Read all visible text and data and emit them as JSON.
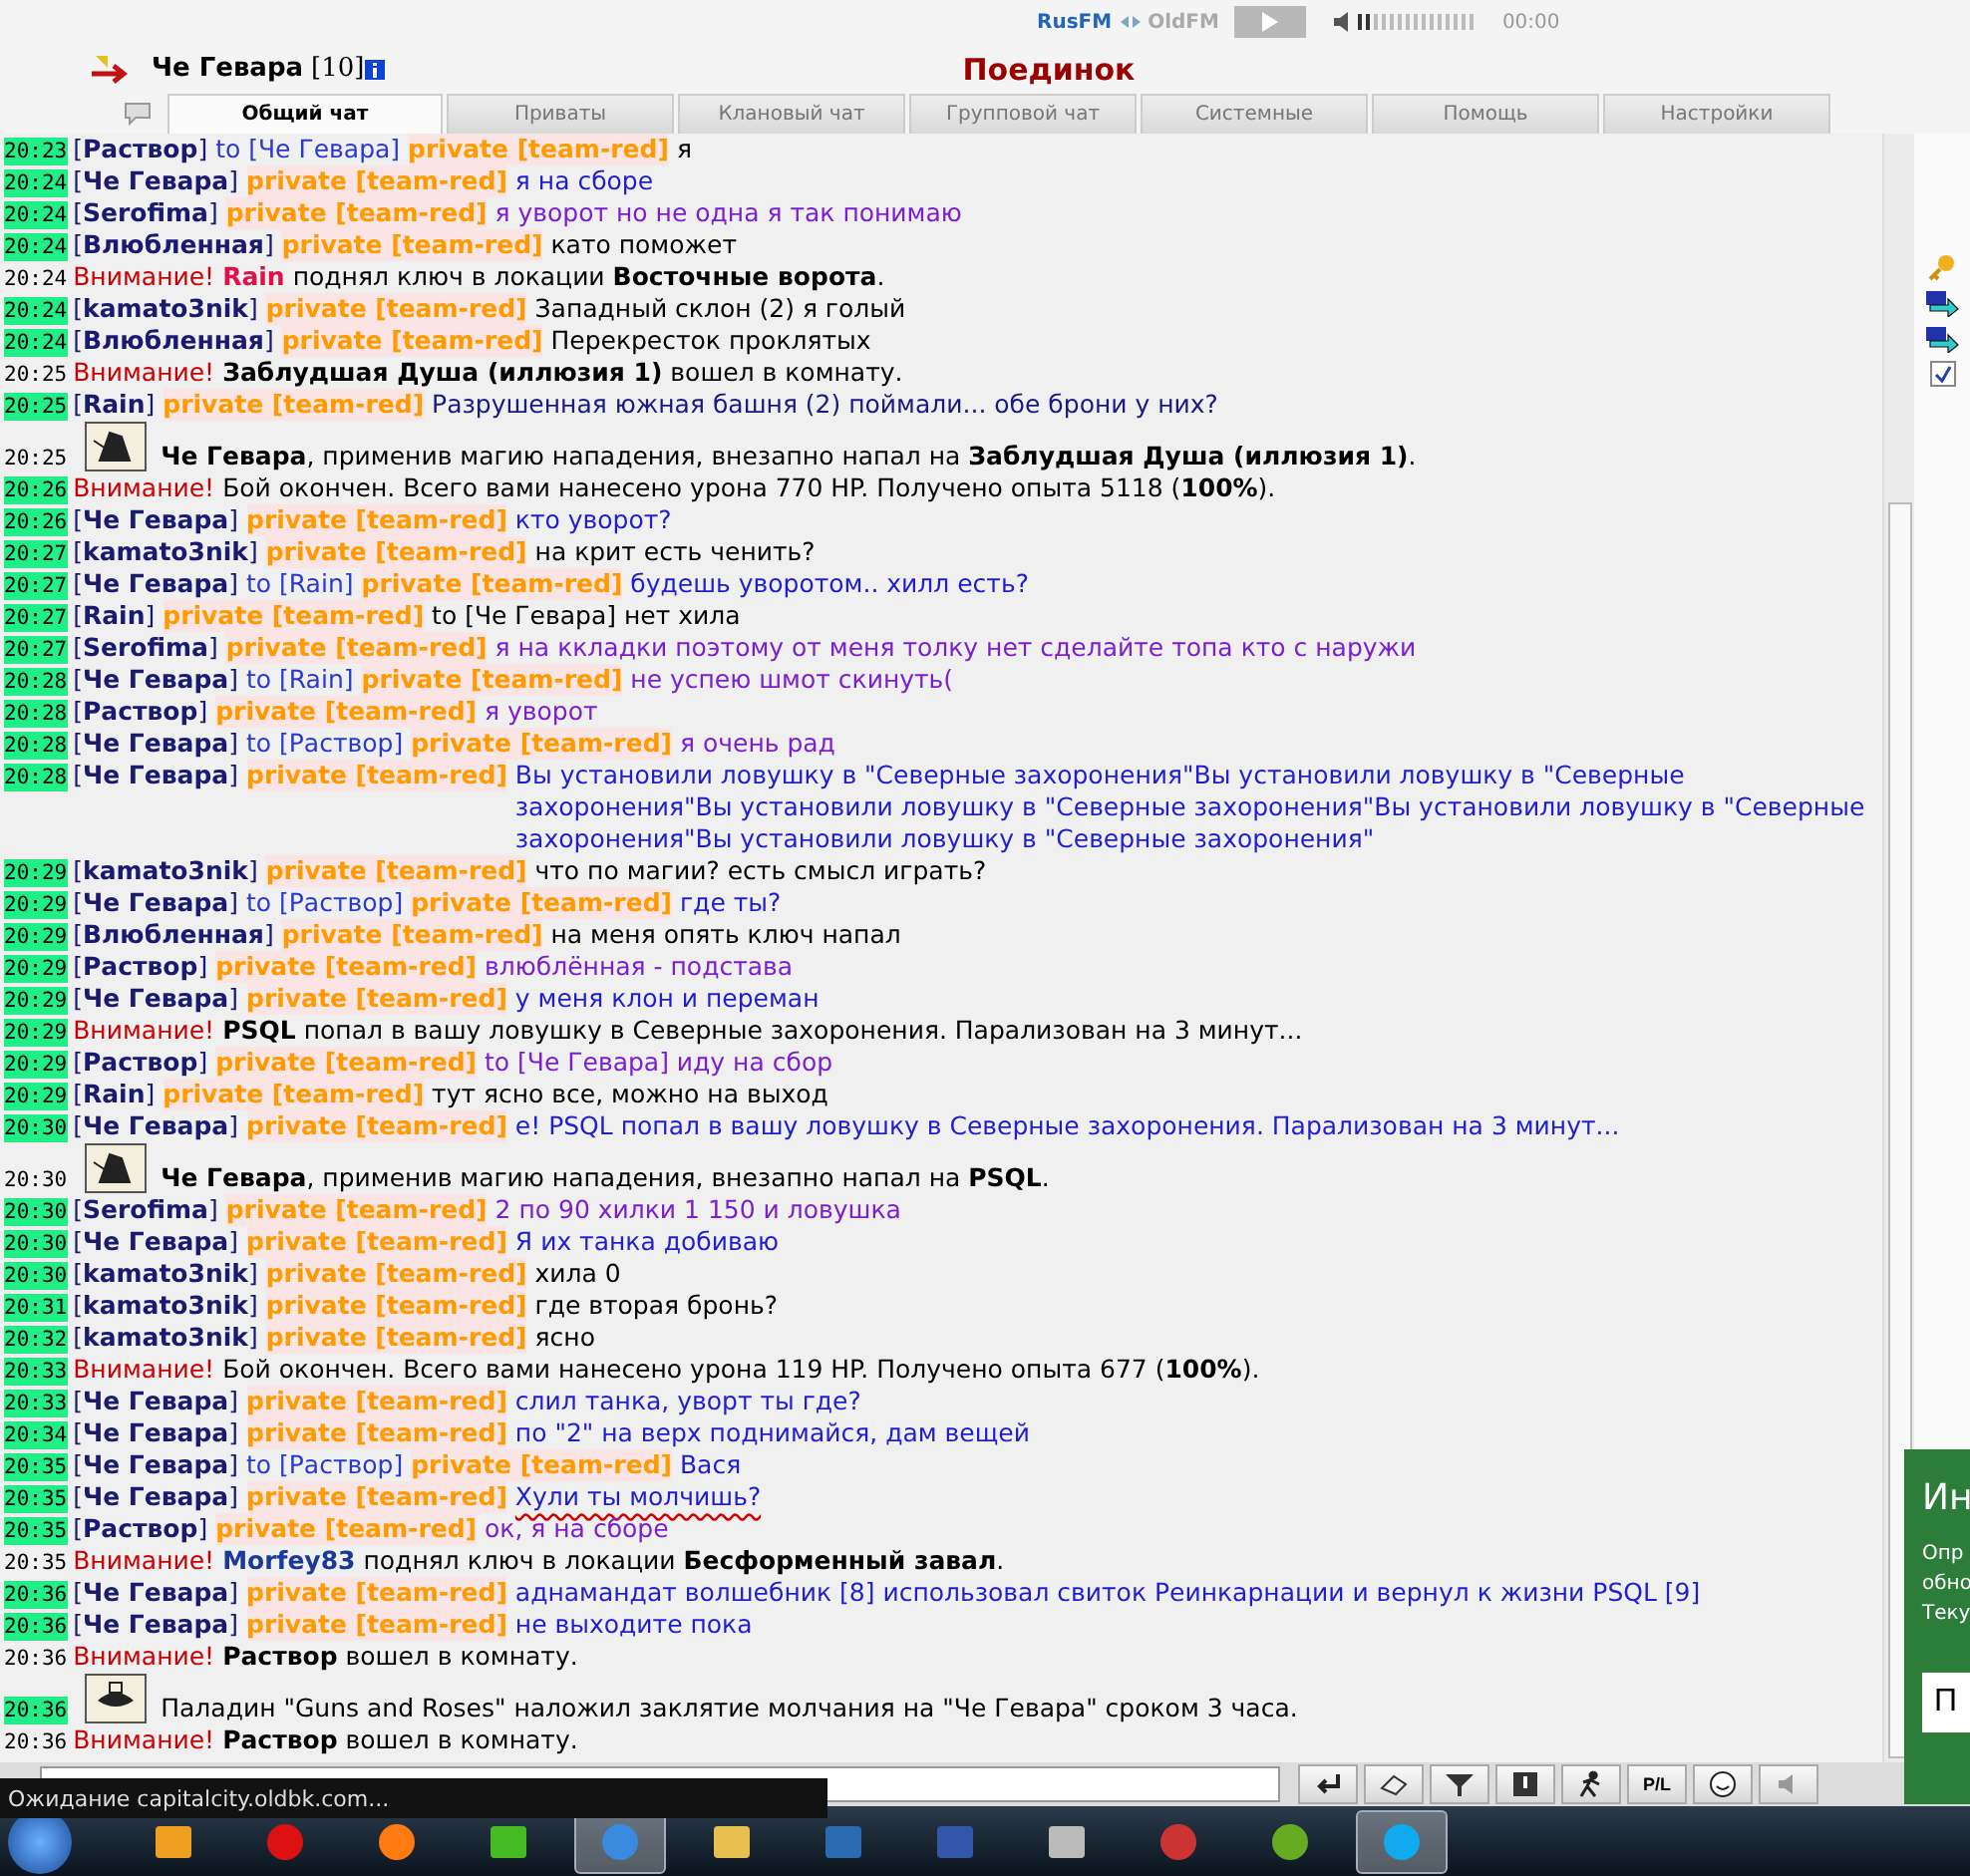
{
  "radio": {
    "station": "RusFM",
    "alt_station": "OldFM",
    "time": "00:00",
    "level": 0.12
  },
  "header": {
    "name": "Че Гевара",
    "level": "[10]",
    "location": "Поединок"
  },
  "tabs": [
    {
      "label": "Общий чат",
      "selected": true
    },
    {
      "label": "Приваты",
      "selected": false
    },
    {
      "label": "Клановый чат",
      "selected": false
    },
    {
      "label": "Групповой чат",
      "selected": false
    },
    {
      "label": "Системные",
      "selected": false
    },
    {
      "label": "Помощь",
      "selected": false
    },
    {
      "label": "Настройки",
      "selected": false
    }
  ],
  "messages": [
    {
      "kind": "private",
      "time": "20:23",
      "highlighted": true,
      "sender": "[**Раствор**]",
      "to": "to [Че Гевара]",
      "channel": "private [team-red]",
      "text": "я",
      "color": "#000000"
    },
    {
      "kind": "private",
      "time": "20:24",
      "highlighted": true,
      "sender": "[**Че Гевара**]",
      "channel": "private [team-red]",
      "text": "я на сборе",
      "color": "#1f1fd0"
    },
    {
      "kind": "private",
      "time": "20:24",
      "highlighted": true,
      "sender": "[**Serofima**]",
      "channel": "private [team-red]",
      "text": "я уворот но не одна я так понимаю",
      "color": "#7b1fd0"
    },
    {
      "kind": "private",
      "time": "20:24",
      "highlighted": true,
      "sender": "[**Влюбленная**]",
      "channel": "private [team-red]",
      "text": "като поможет",
      "color": "#000000"
    },
    {
      "kind": "system",
      "time": "20:24",
      "highlighted": false,
      "alert": "Внимание!",
      "actor": "Rain",
      "color": "#e0104a",
      "text": "поднял ключ в локации **Восточные ворота**."
    },
    {
      "kind": "private",
      "time": "20:24",
      "highlighted": true,
      "sender": "[**kamato3nik**]",
      "channel": "private [team-red]",
      "text": "Западный склон (2) я голый",
      "color": "#000000"
    },
    {
      "kind": "private",
      "time": "20:24",
      "highlighted": true,
      "sender": "[**Влюбленная**]",
      "channel": "private [team-red]",
      "text": "Перекресток проклятых",
      "color": "#000000"
    },
    {
      "kind": "system",
      "time": "20:25",
      "highlighted": false,
      "alert": "Внимание!",
      "text": "**Заблудшая Душа (иллюзия 1)** вошел в комнату."
    },
    {
      "kind": "private",
      "time": "20:25",
      "highlighted": true,
      "sender": "[**Rain**]",
      "channel": "private [team-red]",
      "text": "Разрушенная южная башня (2) поймали... обе брони у них?",
      "color": "#1a1a80"
    },
    {
      "kind": "attack",
      "time": "20:25",
      "highlighted": false,
      "text": "**Че Гевара**, применив магию нападения, внезапно напал на **Заблудшая Душа (иллюзия 1)**."
    },
    {
      "kind": "system",
      "time": "20:26",
      "highlighted": true,
      "alert": "Внимание!",
      "text": "Бой окончен. Всего вами нанесено урона 770 HP. Получено опыта 5118 (**100%**)."
    },
    {
      "kind": "private",
      "time": "20:26",
      "highlighted": true,
      "sender": "[**Че Гевара**]",
      "channel": "private [team-red]",
      "text": "кто уворот?",
      "color": "#1f1fd0"
    },
    {
      "kind": "private",
      "time": "20:27",
      "highlighted": true,
      "sender": "[**kamato3nik**]",
      "channel": "private [team-red]",
      "text": "на крит есть ченить?",
      "color": "#000000"
    },
    {
      "kind": "private",
      "time": "20:27",
      "highlighted": true,
      "sender": "[**Че Гевара**]",
      "to": "to [Rain]",
      "channel": "private [team-red]",
      "text": "будешь уворотом.. хилл есть?",
      "color": "#1f1fd0"
    },
    {
      "kind": "private",
      "time": "20:27",
      "highlighted": true,
      "sender": "[**Rain**]",
      "channel": "private [team-red]",
      "text": "to [Че Гевара] нет хила",
      "color": "#000000"
    },
    {
      "kind": "private",
      "time": "20:27",
      "highlighted": true,
      "sender": "[**Serofima**]",
      "channel": "private [team-red]",
      "text": "я на ккладки поэтому от меня толку нет сделайте топа кто с наружи",
      "color": "#7b1fd0"
    },
    {
      "kind": "private",
      "time": "20:28",
      "highlighted": true,
      "sender": "[**Че Гевара**]",
      "to": "to [Rain]",
      "channel": "private [team-red]",
      "text": "не успею шмот скинуть(",
      "color": "#7b1fd0"
    },
    {
      "kind": "private",
      "time": "20:28",
      "highlighted": true,
      "sender": "[**Раствор**]",
      "channel": "private [team-red]",
      "text": "я уворот",
      "color": "#7b1fd0"
    },
    {
      "kind": "private",
      "time": "20:28",
      "highlighted": true,
      "sender": "[**Че Гевара**]",
      "to": "to [Раствор]",
      "channel": "private [team-red]",
      "text": "я очень рад",
      "color": "#7b1fd0"
    },
    {
      "kind": "private",
      "time": "20:28",
      "highlighted": true,
      "sender": "[**Че Гевара**]",
      "channel": "private [team-red]",
      "text": "Вы установили ловушку в \"Северные захоронения\"Вы установили ловушку в \"Северные захоронения\"Вы установили ловушку в \"Северные захоронения\"Вы установили ловушку в \"Северные захоронения\"Вы установили ловушку в \"Северные захоронения\"",
      "color": "#1f1fd0"
    },
    {
      "kind": "private",
      "time": "20:29",
      "highlighted": true,
      "sender": "[**kamato3nik**]",
      "channel": "private [team-red]",
      "text": "что по магии? есть смысл играть?",
      "color": "#000000"
    },
    {
      "kind": "private",
      "time": "20:29",
      "highlighted": true,
      "sender": "[**Че Гевара**]",
      "to": "to [Раствор]",
      "channel": "private [team-red]",
      "text": "где ты?",
      "color": "#1f1fd0"
    },
    {
      "kind": "private",
      "time": "20:29",
      "highlighted": true,
      "sender": "[**Влюбленная**]",
      "channel": "private [team-red]",
      "text": "на меня опять ключ напал",
      "color": "#000000"
    },
    {
      "kind": "private",
      "time": "20:29",
      "highlighted": true,
      "sender": "[**Раствор**]",
      "channel": "private [team-red]",
      "text": "влюблённая - подстава",
      "color": "#7b1fd0"
    },
    {
      "kind": "private",
      "time": "20:29",
      "highlighted": true,
      "sender": "[**Че Гевара**]",
      "channel": "private [team-red]",
      "text": "у меня клон и переман",
      "color": "#1f1fd0"
    },
    {
      "kind": "system",
      "time": "20:29",
      "highlighted": true,
      "alert": "Внимание!",
      "actor": "PSQL",
      "color": "#000000",
      "text": "попал в вашу ловушку в Северные захоронения. Парализован на 3 минут..."
    },
    {
      "kind": "private",
      "time": "20:29",
      "highlighted": true,
      "sender": "[**Раствор**]",
      "channel": "private [team-red]",
      "text": "to [Че Гевара] иду на сбор",
      "color": "#7b1fd0"
    },
    {
      "kind": "private",
      "time": "20:29",
      "highlighted": true,
      "sender": "[**Rain**]",
      "channel": "private [team-red]",
      "text": "тут ясно все, можно на выход",
      "color": "#000000"
    },
    {
      "kind": "private",
      "time": "20:30",
      "highlighted": true,
      "sender": "[**Че Гевара**]",
      "channel": "private [team-red]",
      "text": "е! PSQL попал в вашу ловушку в Северные захоронения. Парализован на 3 минут...",
      "color": "#1f1fd0"
    },
    {
      "kind": "attack",
      "time": "20:30",
      "highlighted": false,
      "text": "**Че Гевара**, применив магию нападения, внезапно напал на **PSQL**."
    },
    {
      "kind": "private",
      "time": "20:30",
      "highlighted": true,
      "sender": "[**Serofima**]",
      "channel": "private [team-red]",
      "text": "2 по 90 хилки 1 150 и ловушка",
      "color": "#7b1fd0"
    },
    {
      "kind": "private",
      "time": "20:30",
      "highlighted": true,
      "sender": "[**Че Гевара**]",
      "channel": "private [team-red]",
      "text": "Я их танка добиваю",
      "color": "#1f1fd0"
    },
    {
      "kind": "private",
      "time": "20:30",
      "highlighted": true,
      "sender": "[**kamato3nik**]",
      "channel": "private [team-red]",
      "text": "хила 0",
      "color": "#000000"
    },
    {
      "kind": "private",
      "time": "20:31",
      "highlighted": true,
      "sender": "[**kamato3nik**]",
      "channel": "private [team-red]",
      "text": "где вторая бронь?",
      "color": "#000000"
    },
    {
      "kind": "private",
      "time": "20:32",
      "highlighted": true,
      "sender": "[**kamato3nik**]",
      "channel": "private [team-red]",
      "text": "ясно",
      "color": "#000000"
    },
    {
      "kind": "system",
      "time": "20:33",
      "highlighted": true,
      "alert": "Внимание!",
      "text": "Бой окончен. Всего вами нанесено урона 119 HP. Получено опыта 677 (**100%**)."
    },
    {
      "kind": "private",
      "time": "20:33",
      "highlighted": true,
      "sender": "[**Че Гевара**]",
      "channel": "private [team-red]",
      "text": "слил танка, уворт ты где?",
      "color": "#1f1fd0"
    },
    {
      "kind": "private",
      "time": "20:34",
      "highlighted": true,
      "sender": "[**Че Гевара**]",
      "channel": "private [team-red]",
      "text": "по \"2\" на верх поднимайся, дам вещей",
      "color": "#1f1fd0"
    },
    {
      "kind": "private",
      "time": "20:35",
      "highlighted": true,
      "sender": "[**Че Гевара**]",
      "to": "to [Раствор]",
      "channel": "private [team-red]",
      "text": "Вася",
      "color": "#1f1fd0"
    },
    {
      "kind": "private",
      "time": "20:35",
      "highlighted": true,
      "sender": "[**Че Гевара**]",
      "channel": "private [team-red]",
      "text": "Хули ты молчишь?",
      "color": "#1f1fd0",
      "underlined": true
    },
    {
      "kind": "private",
      "time": "20:35",
      "highlighted": true,
      "sender": "[**Раствор**]",
      "channel": "private [team-red]",
      "text": "ок, я на сборе",
      "color": "#7b1fd0"
    },
    {
      "kind": "system",
      "time": "20:35",
      "highlighted": false,
      "alert": "Внимание!",
      "actor": "Morfey83",
      "color": "#1a3a9a",
      "text": "поднял ключ в локации **Бесформенный завал**."
    },
    {
      "kind": "private",
      "time": "20:36",
      "highlighted": true,
      "sender": "[**Че Гевара**]",
      "channel": "private [team-red]",
      "text": "аднамандат волшебник [8] использовал свиток Реинкарнации и вернул к жизни PSQL [9]",
      "color": "#1f1fd0"
    },
    {
      "kind": "private",
      "time": "20:36",
      "highlighted": true,
      "sender": "[**Че Гевара**]",
      "channel": "private [team-red]",
      "text": "не выходите пока",
      "color": "#1f1fd0"
    },
    {
      "kind": "system",
      "time": "20:36",
      "highlighted": false,
      "alert": "Внимание!",
      "text": "**Раствор** вошел в комнату."
    },
    {
      "kind": "silence",
      "time": "20:36",
      "highlighted": true,
      "text": "Паладин \"Guns and Roses\" наложил заклятие молчания на \"Че Гевара\" сроком 3 часа."
    },
    {
      "kind": "system",
      "time": "20:36",
      "highlighted": false,
      "alert": "Внимание!",
      "text": "**Раствор** вошел в комнату."
    }
  ],
  "side_panel": {
    "checked": true
  },
  "toolbar": [
    {
      "kind": "enter"
    },
    {
      "kind": "eraser"
    },
    {
      "kind": "filter"
    },
    {
      "kind": "alert"
    },
    {
      "kind": "runner"
    },
    {
      "kind": "label",
      "label": "P/L"
    },
    {
      "kind": "smile"
    },
    {
      "kind": "sound"
    }
  ],
  "status_tooltip": "Ожидание capitalcity.oldbk.com...",
  "popup": {
    "title": "Ин",
    "lines": [
      "Опр",
      "обно",
      "Теку"
    ],
    "button": "П"
  },
  "taskbar": [
    {
      "kind": "media",
      "active": false
    },
    {
      "kind": "ring",
      "active": false
    },
    {
      "kind": "fox",
      "active": false
    },
    {
      "kind": "cutter",
      "active": false
    },
    {
      "kind": "chrome",
      "active": true
    },
    {
      "kind": "folder",
      "active": false
    },
    {
      "kind": "viewer",
      "active": false
    },
    {
      "kind": "doc",
      "active": false
    },
    {
      "kind": "tools",
      "active": false
    },
    {
      "kind": "target",
      "active": false
    },
    {
      "kind": "leaf",
      "active": false
    },
    {
      "kind": "phone",
      "active": true
    }
  ]
}
